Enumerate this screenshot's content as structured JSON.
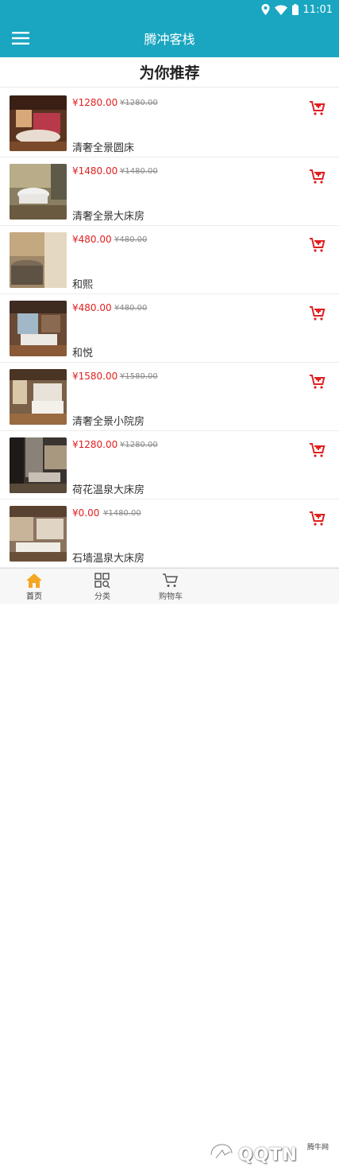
{
  "status": {
    "time": "11:01"
  },
  "app": {
    "title": "腾冲客栈"
  },
  "section": {
    "title": "为你推荐"
  },
  "items": [
    {
      "price": "¥1280.00",
      "old_price": "¥1280.00",
      "name": "清奢全景圆床"
    },
    {
      "price": "¥1480.00",
      "old_price": "¥1480.00",
      "name": "清奢全景大床房"
    },
    {
      "price": "¥480.00",
      "old_price": "¥480.00",
      "name": "和熙"
    },
    {
      "price": "¥480.00",
      "old_price": "¥480.00",
      "name": "和悦"
    },
    {
      "price": "¥1580.00",
      "old_price": "¥1580.00",
      "name": "清奢全景小院房"
    },
    {
      "price": "¥1280.00",
      "old_price": "¥1280.00",
      "name": "荷花温泉大床房"
    },
    {
      "price": "¥0.00",
      "old_price": "¥1480.00",
      "name": "石墙温泉大床房"
    }
  ],
  "tabs": [
    {
      "label": "首页",
      "icon": "home-icon"
    },
    {
      "label": "分类",
      "icon": "grid-search-icon"
    },
    {
      "label": "购物车",
      "icon": "cart-icon"
    }
  ],
  "watermark": {
    "text": "QQTN",
    "small": "腾牛网"
  },
  "colors": {
    "primary": "#1aa6c1",
    "price": "#e02020",
    "home_active": "#f5a623"
  }
}
